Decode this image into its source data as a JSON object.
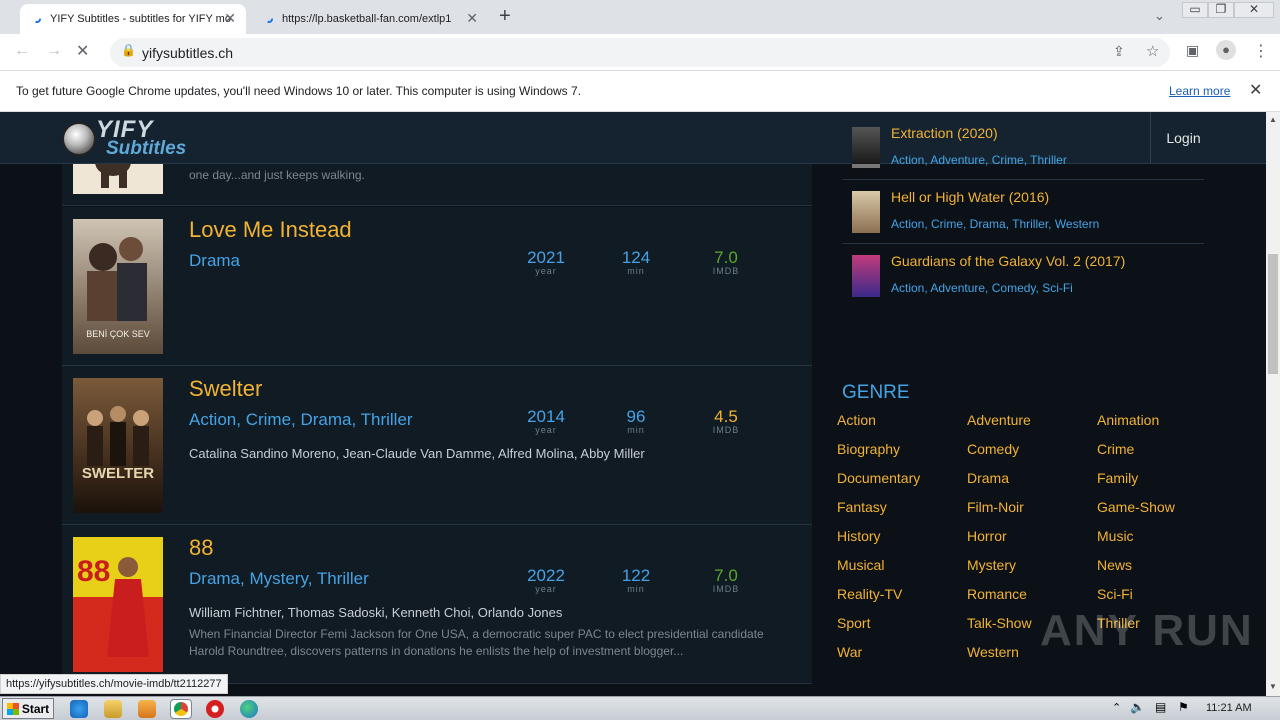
{
  "browser": {
    "tabs": [
      {
        "title": "YIFY Subtitles - subtitles for YIFY mo",
        "active": true
      },
      {
        "title": "https://lp.basketball-fan.com/extlp1",
        "active": false
      }
    ],
    "url": "yifysubtitles.ch",
    "infobar": {
      "message": "To get future Google Chrome updates, you'll need Windows 10 or later. This computer is using Windows 7.",
      "link": "Learn more"
    },
    "status_url": "https://yifysubtitles.ch/movie-imdb/tt2112277"
  },
  "site": {
    "logo_top": "YIFY",
    "logo_bottom": "Subtitles",
    "login_label": "Login"
  },
  "movies": [
    {
      "snippet": "one day...and just keeps walking."
    },
    {
      "title": "Love Me Instead",
      "genres": "Drama",
      "year": "2021",
      "year_label": "year",
      "runtime": "124",
      "runtime_label": "min",
      "rating": "7.0",
      "rating_label": "IMDB",
      "poster_text": "BENİ ÇOK SEV"
    },
    {
      "title": "Swelter",
      "genres": "Action, Crime, Drama, Thriller",
      "year": "2014",
      "year_label": "year",
      "runtime": "96",
      "runtime_label": "min",
      "rating": "4.5",
      "rating_label": "IMDB",
      "cast": "Catalina Sandino Moreno, Jean-Claude Van Damme, Alfred Molina, Abby Miller",
      "poster_text": "SWELTER"
    },
    {
      "title": "88",
      "genres": "Drama, Mystery, Thriller",
      "year": "2022",
      "year_label": "year",
      "runtime": "122",
      "runtime_label": "min",
      "rating": "7.0",
      "rating_label": "IMDB",
      "cast": "William Fichtner, Thomas Sadoski, Kenneth Choi, Orlando Jones",
      "description": "When Financial Director Femi Jackson for One USA, a democratic super PAC to elect presidential candidate Harold Roundtree, discovers patterns in donations he enlists the help of investment blogger...",
      "poster_text": "88"
    }
  ],
  "sidebar": {
    "popular": [
      {
        "title": "Extraction (2020)",
        "genres": "Action, Adventure, Crime, Thriller"
      },
      {
        "title": "Hell or High Water (2016)",
        "genres": "Action, Crime, Drama, Thriller, Western"
      },
      {
        "title": "Guardians of the Galaxy Vol. 2 (2017)",
        "genres": "Action, Adventure, Comedy, Sci-Fi"
      }
    ],
    "genre_heading": "GENRE",
    "genres": [
      "Action",
      "Adventure",
      "Animation",
      "Biography",
      "Comedy",
      "Crime",
      "Documentary",
      "Drama",
      "Family",
      "Fantasy",
      "Film-Noir",
      "Game-Show",
      "History",
      "Horror",
      "Music",
      "Musical",
      "Mystery",
      "News",
      "Reality-TV",
      "Romance",
      "Sci-Fi",
      "Sport",
      "Talk-Show",
      "Thriller",
      "War",
      "Western"
    ]
  },
  "taskbar": {
    "start_label": "Start",
    "clock": "11:21 AM"
  },
  "watermark": "ANY RUN",
  "colors": {
    "accent_orange": "#f2b233",
    "accent_blue": "#45a3e5",
    "rating_green": "#5aa829",
    "page_bg": "#0b1117"
  }
}
